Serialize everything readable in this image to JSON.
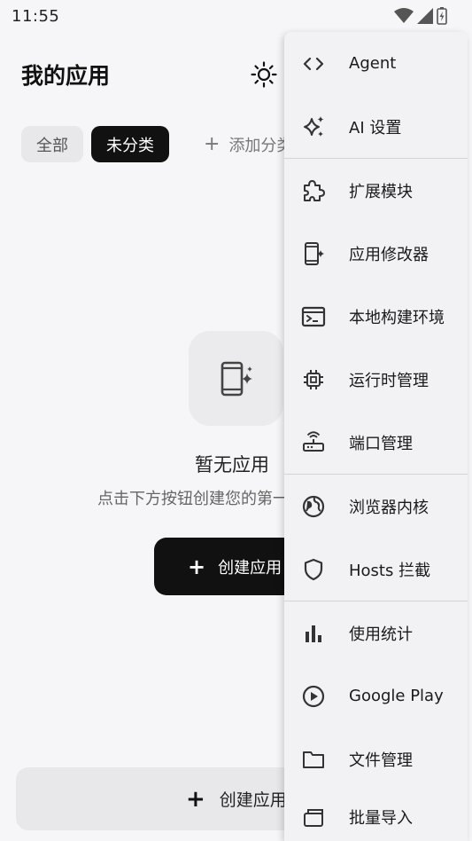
{
  "status": {
    "time": "11:55"
  },
  "header": {
    "title": "我的应用"
  },
  "chips": [
    {
      "label": "全部",
      "active": false
    },
    {
      "label": "未分类",
      "active": true
    }
  ],
  "add_category": {
    "label": "添加分类"
  },
  "empty": {
    "title": "暂无应用",
    "subtitle": "点击下方按钮创建您的第一个应用"
  },
  "create_button": {
    "label": "创建应用"
  },
  "bottom_bar": {
    "label": "创建应用"
  },
  "menu": {
    "items": [
      {
        "label": "Agent",
        "icon": "code-icon"
      },
      {
        "label": "AI 设置",
        "icon": "sparkle-icon"
      },
      {
        "label": "扩展模块",
        "icon": "puzzle-icon"
      },
      {
        "label": "应用修改器",
        "icon": "phone-sparkle-icon"
      },
      {
        "label": "本地构建环境",
        "icon": "terminal-icon"
      },
      {
        "label": "运行时管理",
        "icon": "chip-icon"
      },
      {
        "label": "端口管理",
        "icon": "router-icon"
      },
      {
        "label": "浏览器内核",
        "icon": "globe-icon"
      },
      {
        "label": "Hosts 拦截",
        "icon": "shield-icon"
      },
      {
        "label": "使用统计",
        "icon": "bar-chart-icon"
      },
      {
        "label": "Google Play",
        "icon": "play-circle-icon"
      },
      {
        "label": "文件管理",
        "icon": "folder-icon"
      },
      {
        "label": "批量导入",
        "icon": "import-icon"
      }
    ]
  }
}
